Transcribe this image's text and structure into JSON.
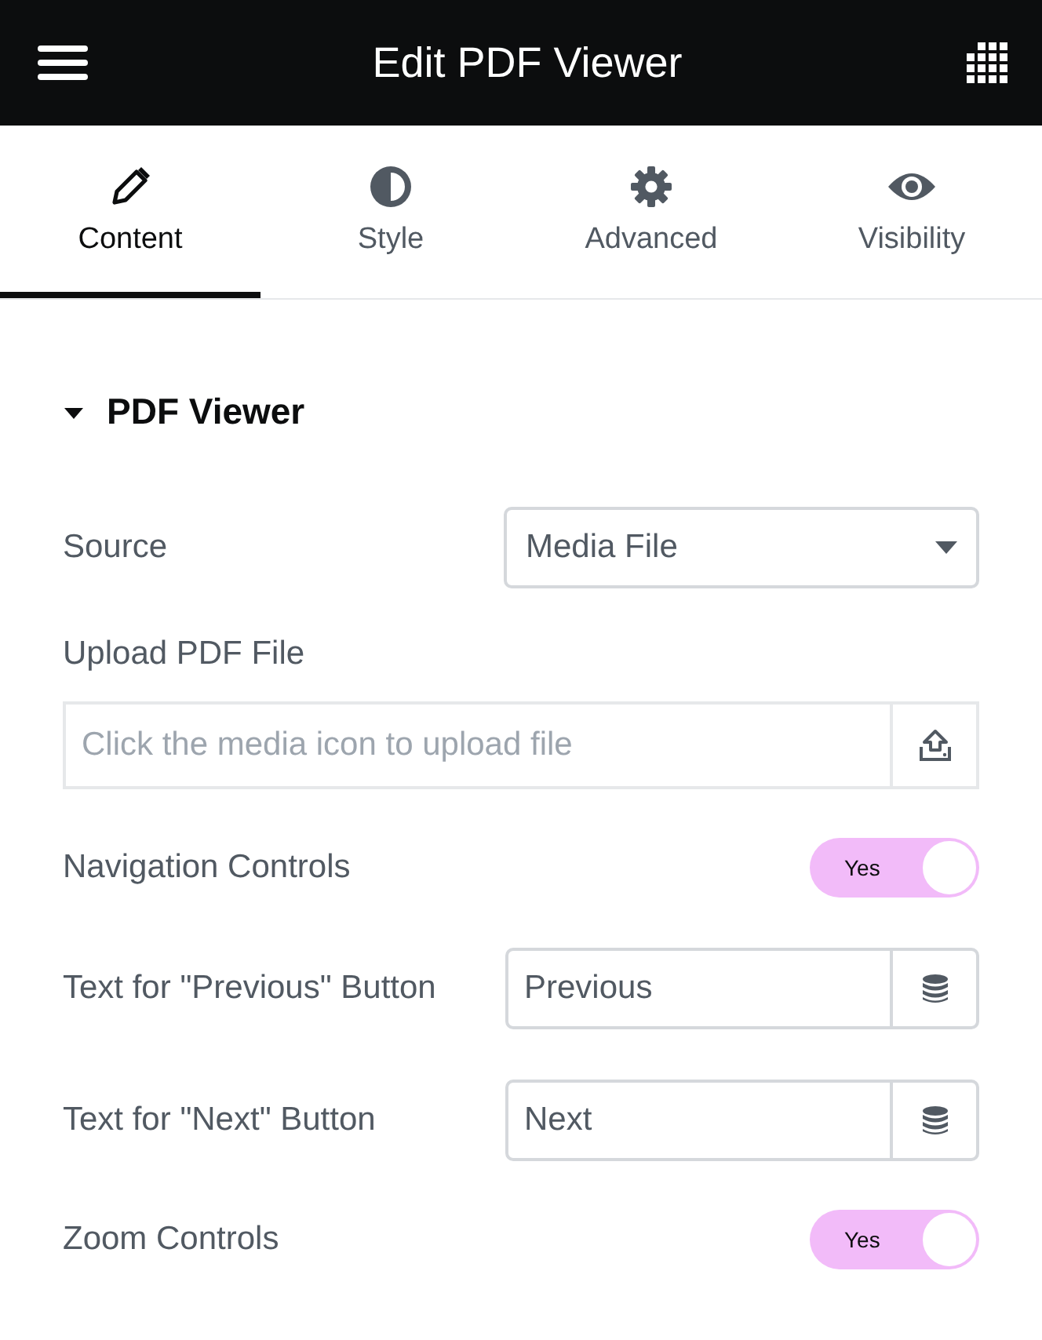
{
  "header": {
    "title": "Edit PDF Viewer"
  },
  "tabs": [
    {
      "label": "Content",
      "kind": "pencil",
      "selected": true
    },
    {
      "label": "Style",
      "kind": "contrast",
      "selected": false
    },
    {
      "label": "Advanced",
      "kind": "gear",
      "selected": false
    },
    {
      "label": "Visibility",
      "kind": "eye",
      "selected": false
    }
  ],
  "section": {
    "title": "PDF Viewer",
    "expanded": true
  },
  "controls": [
    {
      "kind": "select",
      "label": "Source",
      "value": "Media File"
    },
    {
      "kind": "upload",
      "label": "Upload PDF File",
      "placeholder": "Click the media icon to upload file"
    },
    {
      "kind": "switch",
      "label": "Navigation Controls",
      "on": true,
      "on_label": "Yes"
    },
    {
      "kind": "text",
      "label": "Text for \"Previous\" Button",
      "value": "Previous"
    },
    {
      "kind": "text",
      "label": "Text for \"Next\" Button",
      "value": "Next"
    },
    {
      "kind": "switch",
      "label": "Zoom Controls",
      "on": true,
      "on_label": "Yes"
    }
  ]
}
